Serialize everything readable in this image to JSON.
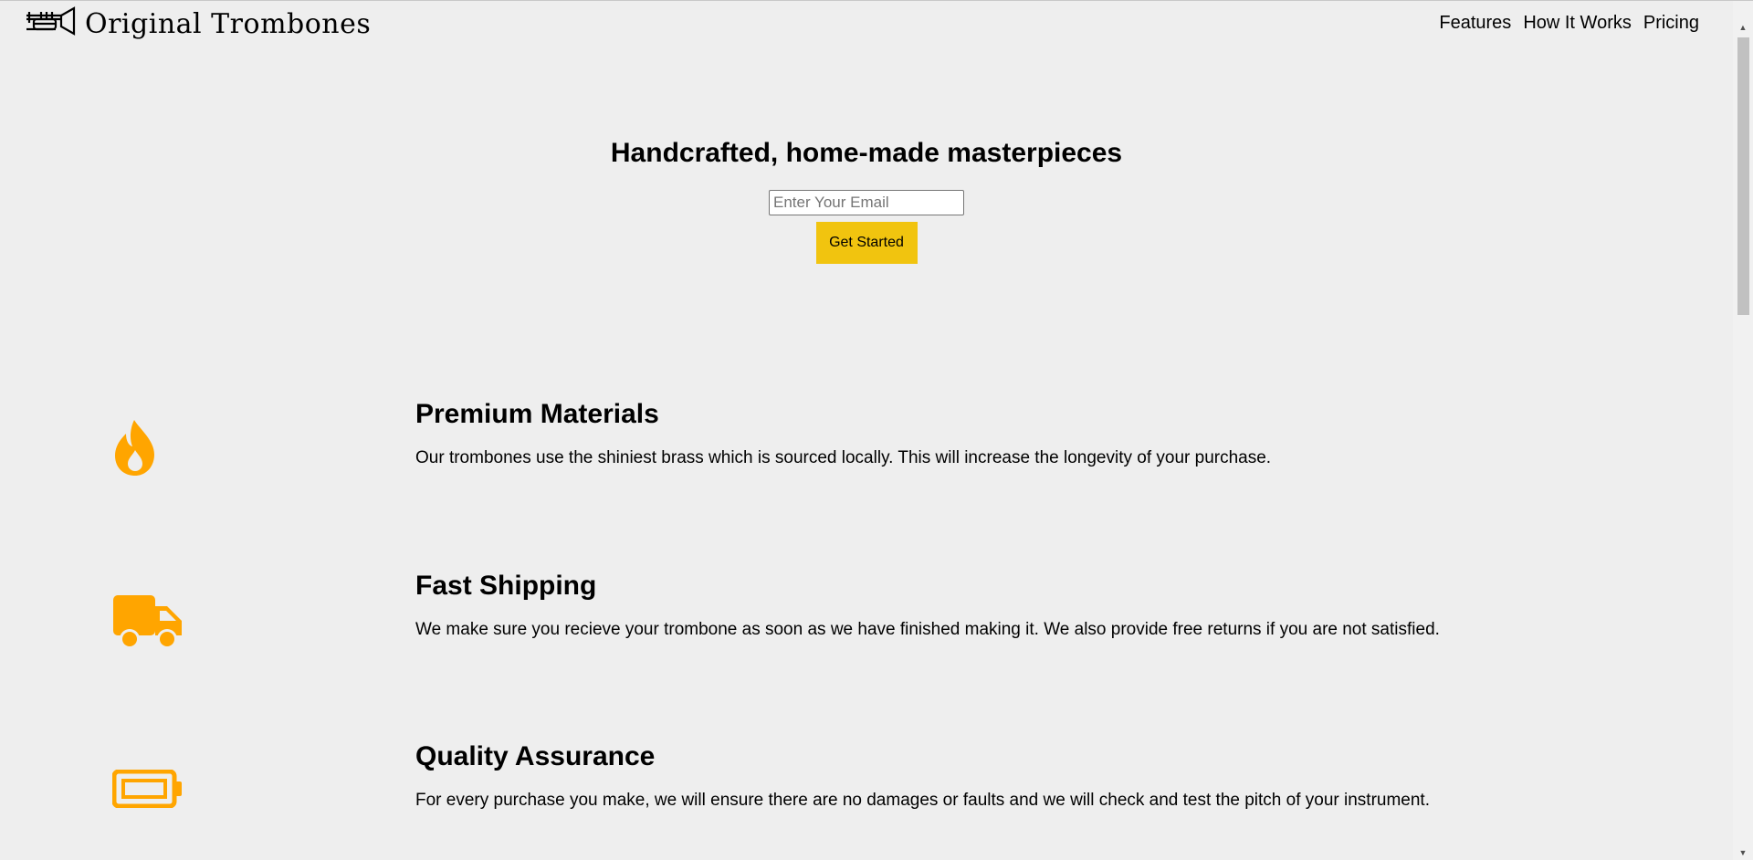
{
  "header": {
    "brand": "Original Trombones",
    "logo_icon": "trombone-icon",
    "nav": [
      {
        "label": "Features"
      },
      {
        "label": "How It Works"
      },
      {
        "label": "Pricing"
      }
    ]
  },
  "hero": {
    "title": "Handcrafted, home-made masterpieces",
    "email_placeholder": "Enter Your Email",
    "email_value": "",
    "cta_label": "Get Started"
  },
  "features": [
    {
      "icon": "fire-icon",
      "title": "Premium Materials",
      "description": "Our trombones use the shiniest brass which is sourced locally. This will increase the longevity of your purchase."
    },
    {
      "icon": "truck-icon",
      "title": "Fast Shipping",
      "description": "We make sure you recieve your trombone as soon as we have finished making it. We also provide free returns if you are not satisfied."
    },
    {
      "icon": "battery-icon",
      "title": "Quality Assurance",
      "description": "For every purchase you make, we will ensure there are no damages or faults and we will check and test the pitch of your instrument."
    }
  ],
  "colors": {
    "background": "#eeeeee",
    "accent": "#f1c40f",
    "icon": "#ffa500"
  }
}
